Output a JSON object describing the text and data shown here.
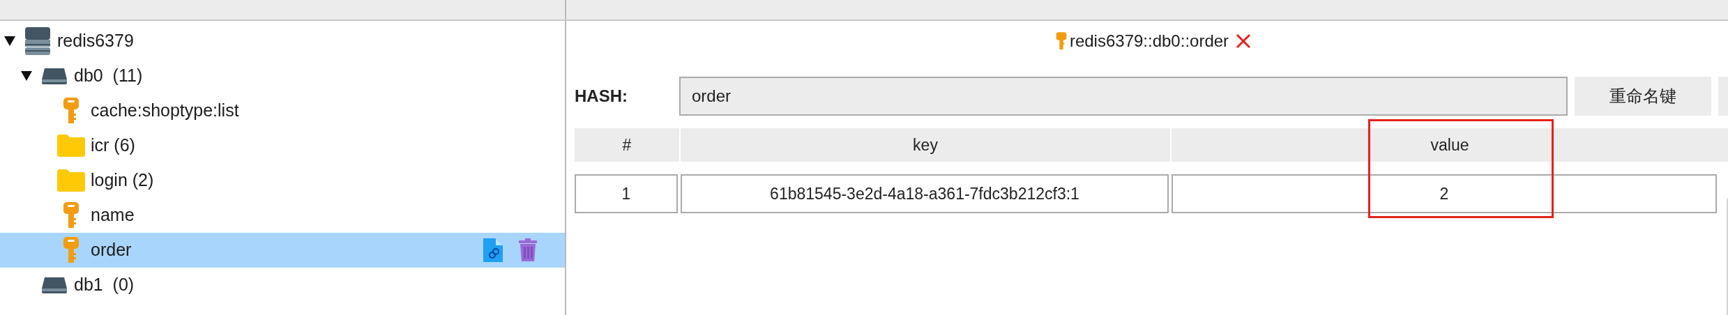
{
  "tree": [
    {
      "kind": "server",
      "label": "redis6379",
      "expanded": true,
      "selected": false,
      "children": [
        {
          "kind": "db",
          "label": "db0  (11)",
          "expanded": true,
          "selected": false,
          "children": [
            {
              "kind": "key",
              "label": "cache:shoptype:list",
              "selected": false
            },
            {
              "kind": "folder",
              "label": "icr (6)",
              "selected": false
            },
            {
              "kind": "folder",
              "label": "login (2)",
              "selected": false
            },
            {
              "kind": "key",
              "label": "name",
              "selected": false
            },
            {
              "kind": "key",
              "label": "order",
              "selected": true
            }
          ]
        },
        {
          "kind": "db",
          "label": "db1  (0)",
          "expanded": false,
          "selected": false
        }
      ]
    }
  ],
  "tab": {
    "title": "redis6379::db0::order"
  },
  "hash": {
    "label": "HASH:",
    "value": "order",
    "rename_button": "重命名键"
  },
  "table": {
    "columns": [
      "#",
      "key",
      "value"
    ],
    "rows": [
      {
        "cells": [
          "1",
          "61b81545-3e2d-4a18-a361-7fdc3b212cf3:1",
          "2"
        ]
      }
    ]
  }
}
